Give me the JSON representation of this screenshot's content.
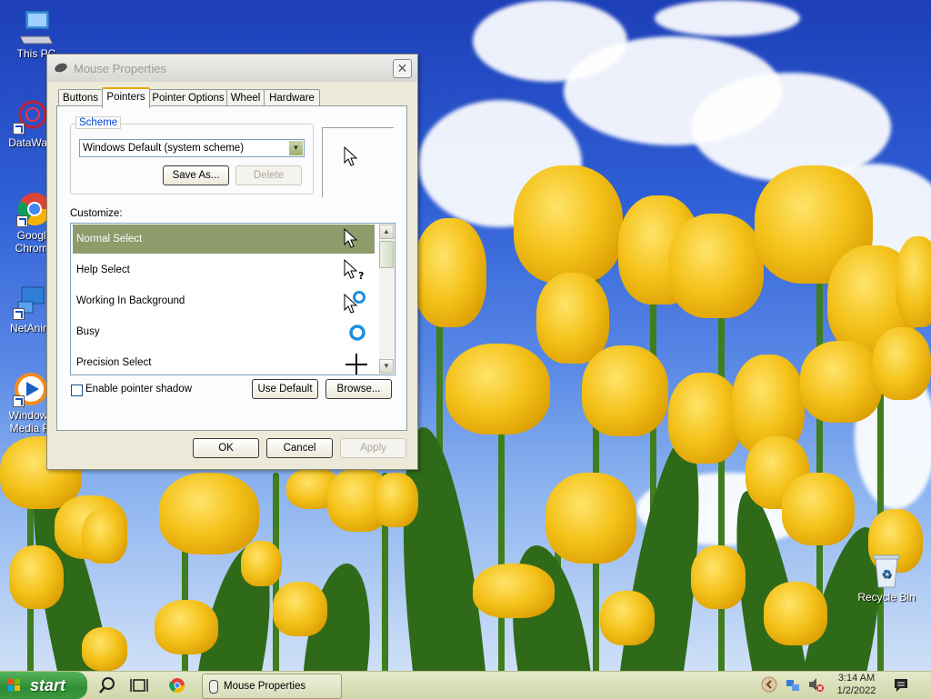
{
  "desktop": {
    "icons": [
      {
        "label": "This PC"
      },
      {
        "label": "DataWag"
      },
      {
        "label": "Google Chrome"
      },
      {
        "label": "NetAnim"
      },
      {
        "label": "Windows Media Pl"
      },
      {
        "label": "Recycle Bin"
      }
    ]
  },
  "window": {
    "title": "Mouse Properties",
    "close_glyph": "✕",
    "tabs": [
      {
        "label": "Buttons"
      },
      {
        "label": "Pointers",
        "active": true
      },
      {
        "label": "Pointer Options"
      },
      {
        "label": "Wheel"
      },
      {
        "label": "Hardware"
      }
    ],
    "scheme": {
      "legend": "Scheme",
      "selected": "Windows Default (system scheme)",
      "save_as_label": "Save As...",
      "delete_label": "Delete"
    },
    "customize_label": "Customize:",
    "pointers": [
      {
        "label": "Normal Select",
        "icon": "arrow-cursor-icon",
        "selected": true
      },
      {
        "label": "Help Select",
        "icon": "help-cursor-icon"
      },
      {
        "label": "Working In Background",
        "icon": "working-cursor-icon"
      },
      {
        "label": "Busy",
        "icon": "busy-cursor-icon"
      },
      {
        "label": "Precision Select",
        "icon": "crosshair-cursor-icon"
      }
    ],
    "shadow_label": "Enable pointer shadow",
    "use_default_label": "Use Default",
    "browse_label": "Browse...",
    "ok_label": "OK",
    "cancel_label": "Cancel",
    "apply_label": "Apply"
  },
  "taskbar": {
    "start_label": "start",
    "task_label": "Mouse Properties",
    "time": "3:14 AM",
    "date": "1/2/2022"
  },
  "colors": {
    "selection": "#8e9b6b",
    "tab_accent": "#e6a800",
    "start_green": "#2f8c33"
  }
}
